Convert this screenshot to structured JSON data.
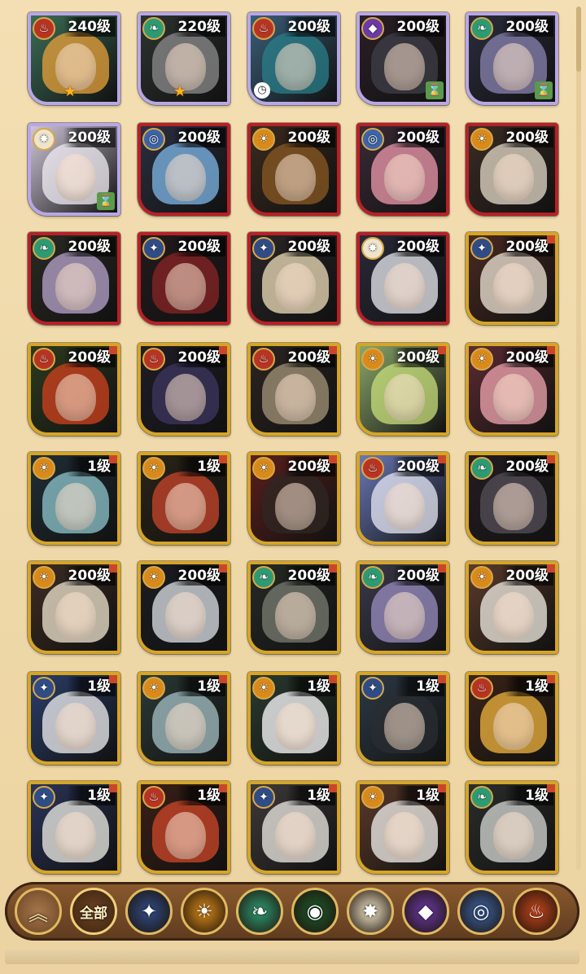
{
  "heroes": [
    {
      "level": "240级",
      "faction": "graveborn",
      "frame": "purple",
      "badge": "star",
      "hair": "#e9a13b",
      "bg": "#3c6d56"
    },
    {
      "level": "220级",
      "faction": "wilder",
      "frame": "purple",
      "badge": "star",
      "hair": "#8c8c8c",
      "bg": "#2d3330"
    },
    {
      "level": "200级",
      "faction": "graveborn",
      "frame": "purple",
      "badge": "clock",
      "hair": "#2a7f8a",
      "bg": "#3a5e78"
    },
    {
      "level": "200级",
      "faction": "hypogean",
      "frame": "purple",
      "badge": "hourglass",
      "hair": "#3f3f48",
      "bg": "#2a1f26"
    },
    {
      "level": "200级",
      "faction": "wilder",
      "frame": "purple",
      "badge": "hourglass",
      "hair": "#8a84b2",
      "bg": "#2b2d3d"
    },
    {
      "level": "200级",
      "faction": "celestial",
      "frame": "purple",
      "badge": "hourglass",
      "hair": "#f1eef4",
      "bg": "#cfc6d8"
    },
    {
      "level": "200级",
      "faction": "dimensional",
      "frame": "red",
      "badge": "",
      "hair": "#7fb8ea",
      "bg": "#2b2f40"
    },
    {
      "level": "200级",
      "faction": "mauler",
      "frame": "red",
      "badge": "",
      "hair": "#8b5a23",
      "bg": "#3a2a1e"
    },
    {
      "level": "200级",
      "faction": "dimensional",
      "frame": "red",
      "badge": "",
      "hair": "#ef9aae",
      "bg": "#3a2a36"
    },
    {
      "level": "200级",
      "faction": "mauler",
      "frame": "red",
      "badge": "",
      "hair": "#e5dccb",
      "bg": "#3b2c24"
    },
    {
      "level": "200级",
      "faction": "wilder",
      "frame": "red",
      "badge": "",
      "hair": "#b9a6cf",
      "bg": "#2a2a24"
    },
    {
      "level": "200级",
      "faction": "lightbearer",
      "frame": "red",
      "badge": "",
      "hair": "#8a2426",
      "bg": "#231a1d"
    },
    {
      "level": "200级",
      "faction": "lightbearer",
      "frame": "red",
      "badge": "",
      "hair": "#f0e0bb",
      "bg": "#2a2628"
    },
    {
      "level": "200级",
      "faction": "celestial",
      "frame": "red",
      "badge": "",
      "hair": "#e9ecf2",
      "bg": "#2a2a3a"
    },
    {
      "level": "200级",
      "faction": "lightbearer",
      "frame": "gold",
      "badge": "",
      "hair": "#f2e7d8",
      "bg": "#4a2a22"
    },
    {
      "level": "200级",
      "faction": "graveborn",
      "frame": "gold",
      "badge": "",
      "hair": "#d1421d",
      "bg": "#2d3a1e"
    },
    {
      "level": "200级",
      "faction": "graveborn",
      "frame": "gold",
      "badge": "",
      "hair": "#3e3760",
      "bg": "#1f1d26"
    },
    {
      "level": "200级",
      "faction": "graveborn",
      "frame": "gold",
      "badge": "",
      "hair": "#a6957a",
      "bg": "#2b2522"
    },
    {
      "level": "200级",
      "faction": "mauler",
      "frame": "gold",
      "badge": "",
      "hair": "#c8df7b",
      "bg": "#8aa66a"
    },
    {
      "level": "200级",
      "faction": "mauler",
      "frame": "gold",
      "badge": "",
      "hair": "#f2a7b2",
      "bg": "#5b2b32"
    },
    {
      "level": "1级",
      "faction": "mauler",
      "frame": "gold",
      "badge": "",
      "hair": "#8fc7cf",
      "bg": "#202f36"
    },
    {
      "level": "1级",
      "faction": "mauler",
      "frame": "gold",
      "badge": "",
      "hair": "#c9462b",
      "bg": "#2b2418"
    },
    {
      "level": "200级",
      "faction": "mauler",
      "frame": "gold",
      "badge": "",
      "hair": "#2f2723",
      "bg": "#5a1f1b"
    },
    {
      "level": "200级",
      "faction": "graveborn",
      "frame": "gold",
      "badge": "",
      "hair": "#e7eaf6",
      "bg": "#6a78b6"
    },
    {
      "level": "200级",
      "faction": "wilder",
      "frame": "gold",
      "badge": "",
      "hair": "#55505a",
      "bg": "#241d22"
    },
    {
      "level": "200级",
      "faction": "mauler",
      "frame": "gold",
      "badge": "",
      "hair": "#f2e7d0",
      "bg": "#3e2d23"
    },
    {
      "level": "200级",
      "faction": "mauler",
      "frame": "gold",
      "badge": "",
      "hair": "#dfe4ea",
      "bg": "#1c1d22"
    },
    {
      "level": "200级",
      "faction": "wilder",
      "frame": "gold",
      "badge": "",
      "hair": "#7a7e72",
      "bg": "#262a26"
    },
    {
      "level": "200级",
      "faction": "wilder",
      "frame": "gold",
      "badge": "",
      "hair": "#9b8fc3",
      "bg": "#3b3a4a"
    },
    {
      "level": "200级",
      "faction": "mauler",
      "frame": "gold",
      "badge": "",
      "hair": "#f3efe6",
      "bg": "#5a3b2a"
    },
    {
      "level": "1级",
      "faction": "lightbearer",
      "frame": "gold",
      "badge": "",
      "hair": "#f1f1f1",
      "bg": "#2b3e6a"
    },
    {
      "level": "1级",
      "faction": "mauler",
      "frame": "gold",
      "badge": "",
      "hair": "#a6c2c6",
      "bg": "#2b3a36"
    },
    {
      "level": "1级",
      "faction": "mauler",
      "frame": "gold",
      "badge": "",
      "hair": "#ffffff",
      "bg": "#2a3a2f"
    },
    {
      "level": "1级",
      "faction": "lightbearer",
      "frame": "gold",
      "badge": "",
      "hair": "#2a2d33",
      "bg": "#2c3a45"
    },
    {
      "level": "1级",
      "faction": "graveborn",
      "frame": "gold",
      "badge": "",
      "hair": "#f1b53e",
      "bg": "#3c2418"
    },
    {
      "level": "1级",
      "faction": "lightbearer",
      "frame": "gold",
      "badge": "",
      "hair": "#f2f0e8",
      "bg": "#2a3458"
    },
    {
      "level": "1级",
      "faction": "graveborn",
      "frame": "gold",
      "badge": "",
      "hair": "#d0472a",
      "bg": "#3b1f16"
    },
    {
      "level": "1级",
      "faction": "lightbearer",
      "frame": "gold",
      "badge": "",
      "hair": "#f0ede7",
      "bg": "#3f3a3a"
    },
    {
      "level": "1级",
      "faction": "mauler",
      "frame": "gold",
      "badge": "",
      "hair": "#f4f2ed",
      "bg": "#5a3a2a"
    },
    {
      "level": "1级",
      "faction": "wilder",
      "frame": "gold",
      "badge": "",
      "hair": "#d8dbd8",
      "bg": "#2b2d2b"
    }
  ],
  "filters": [
    {
      "name": "collapse",
      "label": "",
      "icon": "chevrons-up-icon",
      "color": "#8a5a2e"
    },
    {
      "name": "all",
      "label": "全部",
      "icon": "",
      "color": "#3d2410"
    },
    {
      "name": "lightbearer",
      "label": "",
      "icon": "compass-star-icon",
      "color": "#2f4c86"
    },
    {
      "name": "mauler",
      "label": "",
      "icon": "sun-gear-icon",
      "color": "#d98a1a"
    },
    {
      "name": "wilder",
      "label": "",
      "icon": "leaf-icon",
      "color": "#2e9a72"
    },
    {
      "name": "graveborn",
      "label": "",
      "icon": "eye-icon",
      "color": "#1e5a2e"
    },
    {
      "name": "celestial",
      "label": "",
      "icon": "eight-point-star-icon",
      "color": "#f2e6c8"
    },
    {
      "name": "hypogean",
      "label": "",
      "icon": "void-star-icon",
      "color": "#6b3aa6"
    },
    {
      "name": "dimensional",
      "label": "",
      "icon": "ring-icon",
      "color": "#3d64a6"
    },
    {
      "name": "fire",
      "label": "",
      "icon": "flame-icon",
      "color": "#c2461c"
    }
  ],
  "faction_colors": {
    "lightbearer": "#2f4c86",
    "mauler": "#d98a1a",
    "wilder": "#2e9a72",
    "graveborn": "#b83422",
    "celestial": "#efe4cc",
    "hypogean": "#6b3aa6",
    "dimensional": "#3d64a6"
  },
  "faction_glyphs": {
    "lightbearer": "✦",
    "mauler": "☀",
    "wilder": "❧",
    "graveborn": "♨",
    "celestial": "✸",
    "hypogean": "◆",
    "dimensional": "◎"
  }
}
